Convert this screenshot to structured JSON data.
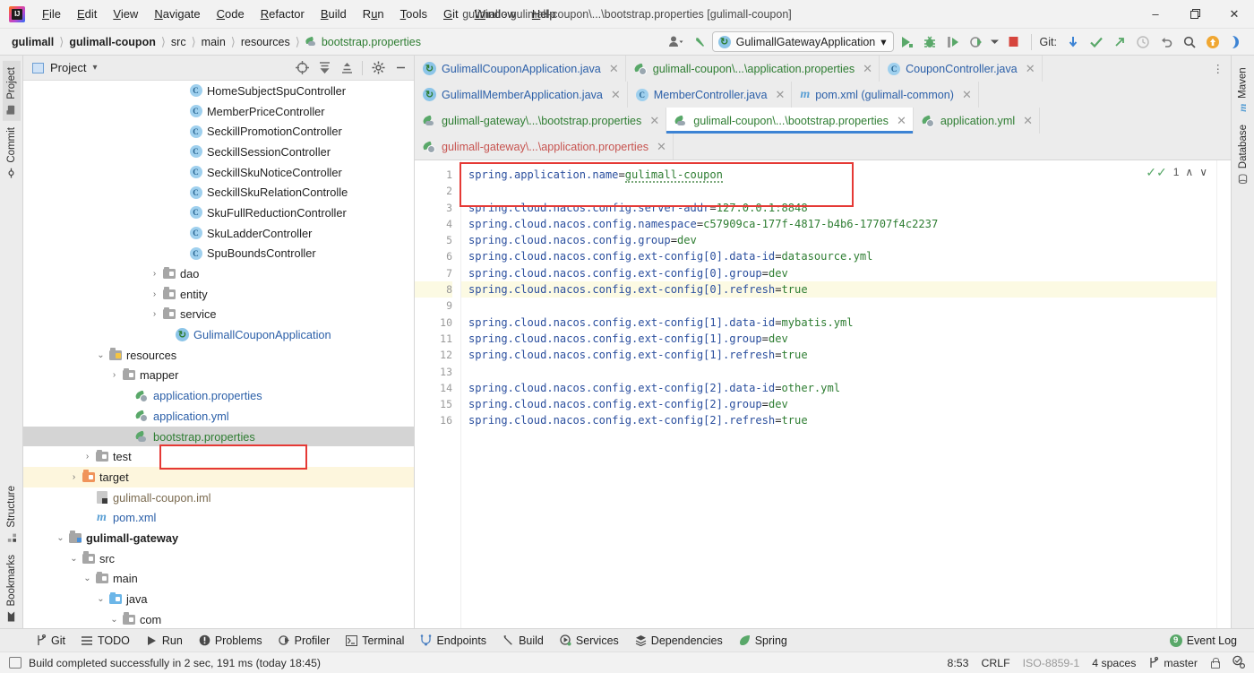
{
  "window": {
    "title": "gulimall - gulimall-coupon\\...\\bootstrap.properties [gulimall-coupon]",
    "minimize": "–",
    "maximize": "❐",
    "close": "✕",
    "logo_text": "IJ"
  },
  "menubar": [
    {
      "label": "File",
      "accel": "F"
    },
    {
      "label": "Edit",
      "accel": "E"
    },
    {
      "label": "View",
      "accel": "V"
    },
    {
      "label": "Navigate",
      "accel": "N"
    },
    {
      "label": "Code",
      "accel": "C"
    },
    {
      "label": "Refactor",
      "accel": "R"
    },
    {
      "label": "Build",
      "accel": "B"
    },
    {
      "label": "Run",
      "accel": "u"
    },
    {
      "label": "Tools",
      "accel": "T"
    },
    {
      "label": "Git",
      "accel": "G"
    },
    {
      "label": "Window",
      "accel": "W"
    },
    {
      "label": "Help",
      "accel": "H"
    }
  ],
  "breadcrumbs": [
    {
      "label": "gulimall",
      "style": "bold"
    },
    {
      "label": "gulimall-coupon",
      "style": "bold"
    },
    {
      "label": "src",
      "style": "normal"
    },
    {
      "label": "main",
      "style": "normal"
    },
    {
      "label": "resources",
      "style": "normal"
    },
    {
      "label": "bootstrap.properties",
      "style": "file"
    }
  ],
  "toolbar": {
    "run_config": "GulimallGatewayApplication",
    "run_config_dropdown": "▾",
    "git_label": "Git:",
    "profile_icon": "user-icon",
    "back_icon": "back-arrow-icon",
    "run_icon": "run-icon",
    "debug_icon": "debug-icon",
    "run_with_coverage_icon": "coverage-icon",
    "profiler_icon": "profiler-icon",
    "stop_icon": "stop-icon",
    "update_project_icon": "update-project-icon",
    "commit_icon": "commit-icon",
    "push_icon": "push-icon",
    "history_icon": "history-icon",
    "rollback_icon": "rollback-icon",
    "search_icon": "search-everywhere-icon",
    "notifications_icon": "notifications-icon",
    "forward_icon": "forward-icon"
  },
  "left_stripe": [
    {
      "label": "Project",
      "icon": "project-icon",
      "active": true
    },
    {
      "label": "Commit",
      "icon": "commit-icon",
      "active": false
    },
    {
      "label": "Structure",
      "icon": "structure-icon",
      "active": false
    },
    {
      "label": "Bookmarks",
      "icon": "bookmarks-icon",
      "active": false
    }
  ],
  "right_stripe": [
    {
      "label": "Maven",
      "icon": "maven-icon"
    },
    {
      "label": "Database",
      "icon": "database-icon"
    }
  ],
  "project_panel": {
    "title": "Project",
    "dropdown": "▾",
    "tools": [
      {
        "name": "select-opened-file-icon",
        "glyph": "⊕"
      },
      {
        "name": "expand-all-icon",
        "glyph": "↧"
      },
      {
        "name": "collapse-all-icon",
        "glyph": "↥"
      },
      {
        "name": "settings-gear-icon",
        "glyph": "⚙"
      },
      {
        "name": "hide-icon",
        "glyph": "−"
      }
    ],
    "tree": [
      {
        "label": "HomeSubjectSpuController",
        "icon": "class-icon",
        "indent": 11,
        "arrow": "none",
        "color": "normal"
      },
      {
        "label": "MemberPriceController",
        "icon": "class-icon",
        "indent": 11,
        "arrow": "none",
        "color": "normal"
      },
      {
        "label": "SeckillPromotionController",
        "icon": "class-icon",
        "indent": 11,
        "arrow": "none",
        "color": "normal"
      },
      {
        "label": "SeckillSessionController",
        "icon": "class-icon",
        "indent": 11,
        "arrow": "none",
        "color": "normal"
      },
      {
        "label": "SeckillSkuNoticeController",
        "icon": "class-icon",
        "indent": 11,
        "arrow": "none",
        "color": "normal"
      },
      {
        "label": "SeckillSkuRelationControlle",
        "icon": "class-icon",
        "indent": 11,
        "arrow": "none",
        "color": "normal"
      },
      {
        "label": "SkuFullReductionController",
        "icon": "class-icon",
        "indent": 11,
        "arrow": "none",
        "color": "normal"
      },
      {
        "label": "SkuLadderController",
        "icon": "class-icon",
        "indent": 11,
        "arrow": "none",
        "color": "normal"
      },
      {
        "label": "SpuBoundsController",
        "icon": "class-icon",
        "indent": 11,
        "arrow": "none",
        "color": "normal"
      },
      {
        "label": "dao",
        "icon": "folder-icon",
        "indent": 9,
        "arrow": "collapsed",
        "color": "normal"
      },
      {
        "label": "entity",
        "icon": "folder-icon",
        "indent": 9,
        "arrow": "collapsed",
        "color": "normal"
      },
      {
        "label": "service",
        "icon": "folder-icon",
        "indent": 9,
        "arrow": "collapsed",
        "color": "normal"
      },
      {
        "label": "GulimallCouponApplication",
        "icon": "spring-boot-class-icon",
        "indent": 10,
        "arrow": "none",
        "color": "blue"
      },
      {
        "label": "resources",
        "icon": "resources-folder-icon",
        "indent": 5,
        "arrow": "expanded",
        "color": "normal"
      },
      {
        "label": "mapper",
        "icon": "folder-icon",
        "indent": 6,
        "arrow": "collapsed",
        "color": "normal"
      },
      {
        "label": "application.properties",
        "icon": "spring-config-icon",
        "indent": 7,
        "arrow": "none",
        "color": "blue"
      },
      {
        "label": "application.yml",
        "icon": "spring-config-icon",
        "indent": 7,
        "arrow": "none",
        "color": "blue"
      },
      {
        "label": "bootstrap.properties",
        "icon": "spring-icon",
        "indent": 7,
        "arrow": "none",
        "color": "green",
        "selected": true,
        "highlighted": true
      },
      {
        "label": "test",
        "icon": "folder-icon",
        "indent": 4,
        "arrow": "collapsed",
        "color": "normal"
      },
      {
        "label": "target",
        "icon": "target-folder-icon",
        "indent": 3,
        "arrow": "collapsed",
        "color": "normal",
        "rowhl": true
      },
      {
        "label": "gulimall-coupon.iml",
        "icon": "iml-icon",
        "indent": 4,
        "arrow": "none",
        "color": "tan"
      },
      {
        "label": "pom.xml",
        "icon": "maven-icon",
        "indent": 4,
        "arrow": "none",
        "color": "blue"
      },
      {
        "label": "gulimall-gateway",
        "icon": "module-folder-icon",
        "indent": 2,
        "arrow": "expanded",
        "color": "bold"
      },
      {
        "label": "src",
        "icon": "folder-icon",
        "indent": 3,
        "arrow": "expanded",
        "color": "normal"
      },
      {
        "label": "main",
        "icon": "folder-icon",
        "indent": 4,
        "arrow": "expanded",
        "color": "normal"
      },
      {
        "label": "java",
        "icon": "java-folder-icon",
        "indent": 5,
        "arrow": "expanded",
        "color": "normal"
      },
      {
        "label": "com",
        "icon": "folder-icon",
        "indent": 6,
        "arrow": "expanded",
        "color": "normal"
      }
    ]
  },
  "editor_tabs": {
    "row1": [
      {
        "label": "GulimallCouponApplication.java",
        "icon": "spring-boot-class-icon",
        "color": "blue",
        "active": false
      },
      {
        "label": "gulimall-coupon\\...\\application.properties",
        "icon": "spring-config-icon",
        "color": "green",
        "active": false
      },
      {
        "label": "CouponController.java",
        "icon": "class-icon",
        "color": "blue",
        "active": false
      }
    ],
    "row2": [
      {
        "label": "GulimallMemberApplication.java",
        "icon": "spring-boot-class-icon",
        "color": "blue",
        "active": false
      },
      {
        "label": "MemberController.java",
        "icon": "class-icon",
        "color": "blue",
        "active": false
      },
      {
        "label": "pom.xml (gulimall-common)",
        "icon": "maven-icon",
        "color": "blue",
        "active": false
      }
    ],
    "row3": [
      {
        "label": "gulimall-gateway\\...\\bootstrap.properties",
        "icon": "spring-icon",
        "color": "green",
        "active": false
      },
      {
        "label": "gulimall-coupon\\...\\bootstrap.properties",
        "icon": "spring-icon",
        "color": "green",
        "active": true
      },
      {
        "label": "application.yml",
        "icon": "spring-config-icon",
        "color": "green",
        "active": false
      }
    ],
    "row4": [
      {
        "label": "gulimall-gateway\\...\\application.properties",
        "icon": "spring-config-icon",
        "color": "red",
        "active": false
      }
    ],
    "close_glyph": "✕",
    "more_glyph": "⋮"
  },
  "code": {
    "line_numbers": [
      "1",
      "2",
      "3",
      "4",
      "5",
      "6",
      "7",
      "8",
      "9",
      "10",
      "11",
      "12",
      "13",
      "14",
      "15",
      "16"
    ],
    "lines": [
      {
        "n": 1,
        "key": "spring.application.name",
        "eq": "=",
        "val": "gulimall-coupon",
        "squiggle": true
      },
      {
        "n": 2,
        "key": "",
        "eq": "",
        "val": ""
      },
      {
        "n": 3,
        "key": "spring.cloud.nacos.config.server-addr",
        "eq": "=",
        "val": "127.0.0.1:8848"
      },
      {
        "n": 4,
        "key": "spring.cloud.nacos.config.namespace",
        "eq": "=",
        "val": "c57909ca-177f-4817-b4b6-17707f4c2237"
      },
      {
        "n": 5,
        "key": "spring.cloud.nacos.config.group",
        "eq": "=",
        "val": "dev"
      },
      {
        "n": 6,
        "key": "spring.cloud.nacos.config.ext-config[0].data-id",
        "eq": "=",
        "val": "datasource.yml"
      },
      {
        "n": 7,
        "key": "spring.cloud.nacos.config.ext-config[0].group",
        "eq": "=",
        "val": "dev"
      },
      {
        "n": 8,
        "key": "spring.cloud.nacos.config.ext-config[0].refresh",
        "eq": "=",
        "val": "true",
        "highlight": true
      },
      {
        "n": 9,
        "key": "",
        "eq": "",
        "val": ""
      },
      {
        "n": 10,
        "key": "spring.cloud.nacos.config.ext-config[1].data-id",
        "eq": "=",
        "val": "mybatis.yml"
      },
      {
        "n": 11,
        "key": "spring.cloud.nacos.config.ext-config[1].group",
        "eq": "=",
        "val": "dev"
      },
      {
        "n": 12,
        "key": "spring.cloud.nacos.config.ext-config[1].refresh",
        "eq": "=",
        "val": "true"
      },
      {
        "n": 13,
        "key": "",
        "eq": "",
        "val": ""
      },
      {
        "n": 14,
        "key": "spring.cloud.nacos.config.ext-config[2].data-id",
        "eq": "=",
        "val": "other.yml"
      },
      {
        "n": 15,
        "key": "spring.cloud.nacos.config.ext-config[2].group",
        "eq": "=",
        "val": "dev"
      },
      {
        "n": 16,
        "key": "spring.cloud.nacos.config.ext-config[2].refresh",
        "eq": "=",
        "val": "true"
      }
    ],
    "inspection_count": "1",
    "inspection_icon": "inspection-ok-icon",
    "prev_glyph": "∧",
    "next_glyph": "∨"
  },
  "bottom_bar": {
    "items": [
      {
        "label": "Git",
        "icon": "git-branch-icon"
      },
      {
        "label": "TODO",
        "icon": "todo-list-icon"
      },
      {
        "label": "Run",
        "icon": "run-play-icon"
      },
      {
        "label": "Problems",
        "icon": "problems-icon"
      },
      {
        "label": "Profiler",
        "icon": "profiler-icon"
      },
      {
        "label": "Terminal",
        "icon": "terminal-icon"
      },
      {
        "label": "Endpoints",
        "icon": "endpoints-icon"
      },
      {
        "label": "Build",
        "icon": "build-hammer-icon"
      },
      {
        "label": "Services",
        "icon": "services-icon"
      },
      {
        "label": "Dependencies",
        "icon": "dependencies-icon"
      },
      {
        "label": "Spring",
        "icon": "spring-leaf-icon"
      }
    ],
    "event_log": {
      "label": "Event Log",
      "badge": "9"
    }
  },
  "status_bar": {
    "message": "Build completed successfully in 2 sec, 191 ms (today 18:45)",
    "message_icon": "build-status-icon",
    "caret": "8:53",
    "line_separator": "CRLF",
    "encoding": "ISO-8859-1",
    "indent": "4 spaces",
    "branch": "master",
    "branch_icon": "git-branch-icon",
    "lock_icon": "read-write-lock-icon",
    "inspection_icon": "inspection-profile-icon"
  },
  "colors": {
    "accent_blue": "#3c83d4",
    "spring_green": "#2e7d32",
    "annotation_red": "#e53935",
    "selection_gray": "#d4d4d4",
    "highlight_yellow": "#fdf6dd"
  }
}
